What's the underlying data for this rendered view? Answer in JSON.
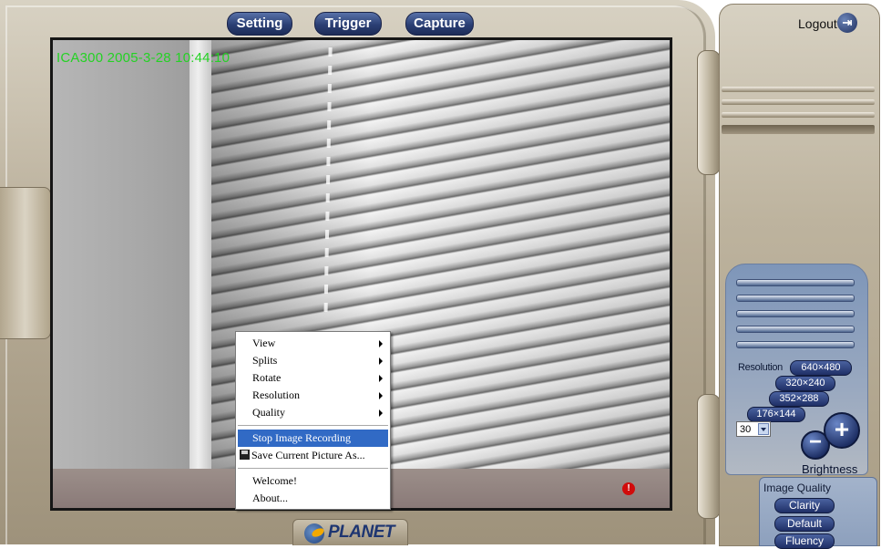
{
  "toolbar": {
    "setting": "Setting",
    "trigger": "Trigger",
    "capture": "Capture"
  },
  "video": {
    "osd_text": "ICA300  2005-3-28  10:44:10",
    "recording_indicator": "!"
  },
  "context_menu": {
    "items": [
      {
        "label": "View",
        "submenu": true
      },
      {
        "label": "Splits",
        "submenu": true
      },
      {
        "label": "Rotate",
        "submenu": true
      },
      {
        "label": "Resolution",
        "submenu": true
      },
      {
        "label": "Quality",
        "submenu": true
      },
      {
        "label": "Stop Image Recording",
        "selected": true
      },
      {
        "label": "Save Current Picture As..."
      },
      {
        "label": "Welcome!"
      },
      {
        "label": "About..."
      }
    ]
  },
  "logo": {
    "text": "PLANET"
  },
  "right_panel": {
    "logout": "Logout",
    "resolution_label": "Resolution",
    "resolutions": [
      "640×480",
      "320×240",
      "352×288",
      "176×144"
    ],
    "fps_value": "30",
    "brightness_label": "Brightness",
    "brightness_minus": "−",
    "brightness_plus": "+",
    "image_quality_label": "Image Quality",
    "image_quality": [
      "Clarity",
      "Default",
      "Fluency"
    ]
  },
  "colors": {
    "accent_blue": "#2b3f74",
    "osd_green": "#24d224",
    "menu_highlight": "#316ac5",
    "record_red": "#d10b0b"
  },
  "icons": [
    "logout-icon",
    "submenu-arrow-icon",
    "floppy-disk-icon",
    "dropdown-arrow-icon",
    "record-alert-icon",
    "planet-globe-icon"
  ]
}
